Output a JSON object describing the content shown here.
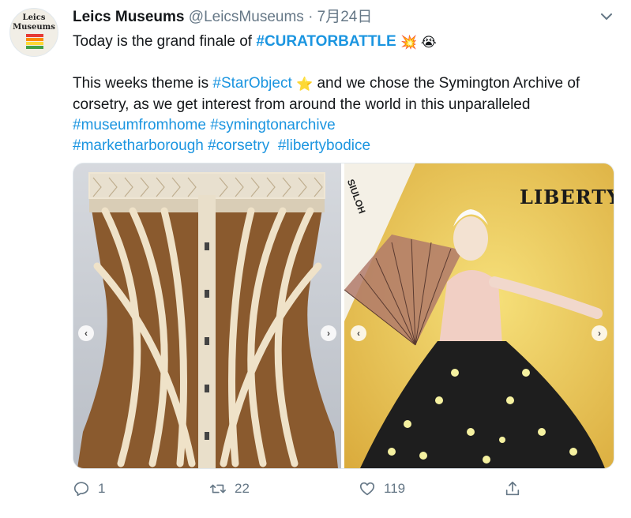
{
  "tweet": {
    "avatar": {
      "line1": "Leics",
      "line2": "Museums"
    },
    "author_name": "Leics Museums",
    "handle": "@LeicsMuseums",
    "separator": "·",
    "date": "7月24日",
    "line1_text": "Today is the grand finale of ",
    "line1_hashtag": "#CURATORBATTLE",
    "line1_emojis": "💥 😭",
    "p2_text1": "This weeks theme is ",
    "p2_hashtag1": "#StarObject",
    "p2_emoji": "⭐",
    "p2_text2": " and we chose the Symington Archive of corsetry, as we get interest from around the world in this unparalleled ",
    "p2_hashtag2": "#museumfromhome",
    "p2_hashtag3": "#symingtonarchive",
    "p2_hashtag4": "#marketharborough",
    "p2_hashtag5": "#corsetry",
    "p2_hashtag6": "#libertybodice",
    "media": {
      "left_image": "corset-photo",
      "right_image": "liberty-poster",
      "poster_logo": "LIBERTY",
      "poster_corner": "SIULOH",
      "nav_prev": "‹",
      "nav_next": "›"
    },
    "actions": {
      "reply_count": "1",
      "retweet_count": "22",
      "like_count": "119"
    }
  },
  "colors": {
    "link": "#1b95e0",
    "muted": "#657786",
    "text": "#14171a"
  }
}
